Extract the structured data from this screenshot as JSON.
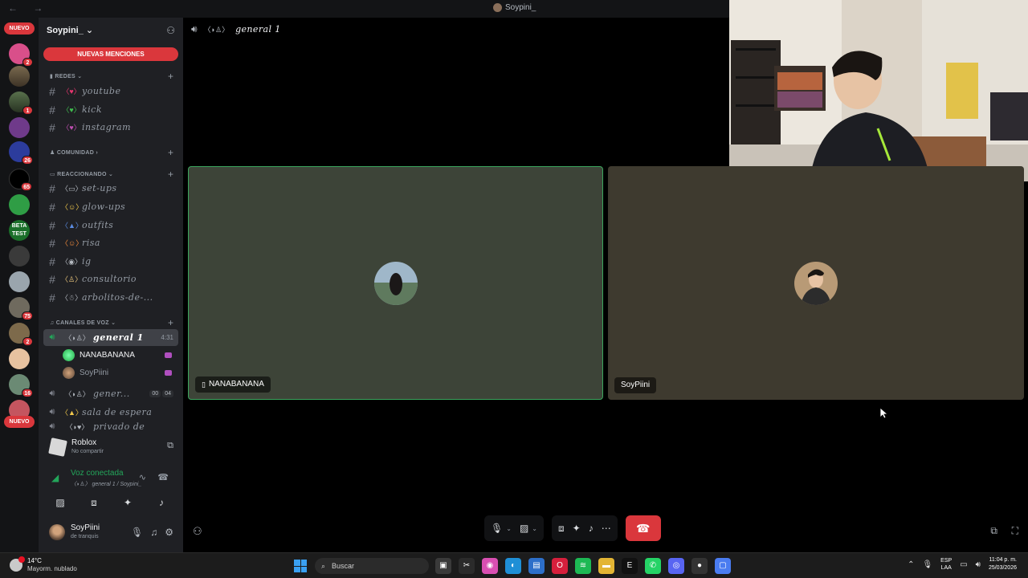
{
  "window": {
    "title": "Soypini_",
    "nav_arrows": "← →"
  },
  "servers": {
    "nuevo_top": "NUEVO",
    "nuevo_bottom": "NUEVO",
    "badges": [
      "2",
      "1",
      "26",
      "65",
      "2",
      "75",
      "2",
      "16"
    ]
  },
  "sidebar": {
    "server_name": "Soypini_",
    "server_chevron": "⌄",
    "mentions_label": "NUEVAS MENCIONES",
    "categories": {
      "redes": "REDES",
      "comunidad": "COMUNIDAD",
      "reaccionando": "REACCIONANDO",
      "voz": "CANALES DE VOZ"
    },
    "channels_redes": [
      {
        "emoji": "〈♥〉",
        "name": "youtube"
      },
      {
        "emoji": "〈♥〉",
        "name": "kick"
      },
      {
        "emoji": "〈♥〉",
        "name": "instagram"
      }
    ],
    "channels_reacc": [
      {
        "emoji": "〈▭〉",
        "name": "set-ups"
      },
      {
        "emoji": "〈☺〉",
        "name": "glow-ups"
      },
      {
        "emoji": "〈▲〉",
        "name": "outfits"
      },
      {
        "emoji": "〈☺〉",
        "name": "risa"
      },
      {
        "emoji": "〈◉〉",
        "name": "ig"
      },
      {
        "emoji": "〈♙〉",
        "name": "consultorio"
      },
      {
        "emoji": "〈☃〉",
        "name": "arbolitos-de-..."
      }
    ],
    "voice_active": {
      "emoji": "〈◗♙〉",
      "name": "general 1",
      "timer": "4:31"
    },
    "voice_users": [
      {
        "name": "NANABANANA"
      },
      {
        "name": "SoyPiini"
      }
    ],
    "voice_other": [
      {
        "emoji": "〈◗♙〉",
        "name": "gener...",
        "pill1": "00",
        "pill2": "04"
      },
      {
        "emoji": "〈▲〉",
        "name": "sala de espera"
      },
      {
        "emoji": "〈◗♥〉",
        "name": "privado de"
      }
    ]
  },
  "activity": {
    "name": "Roblox",
    "sub": "No compartir"
  },
  "voice_connection": {
    "title": "Voz conectada",
    "sub": "〈◗♙〉 general 1 / Soypini_"
  },
  "user": {
    "name": "SoyPiini",
    "status": "de tranquis"
  },
  "call": {
    "header_emoji": "〈◗♙〉",
    "header_name": "general 1",
    "participants": [
      {
        "name": "NANABANANA"
      },
      {
        "name": "SoyPiini"
      }
    ]
  },
  "taskbar": {
    "temperature": "14°C",
    "weather": "Mayorm. nublado",
    "search_placeholder": "Buscar",
    "lang_top": "ESP",
    "lang_bottom": "LAA",
    "time": "11:04 p. m.",
    "date": "25/03/2026"
  },
  "colors": {
    "accent_red": "#da373c",
    "connected_green": "#23a55a",
    "speaking_border": "#3ba55d"
  }
}
